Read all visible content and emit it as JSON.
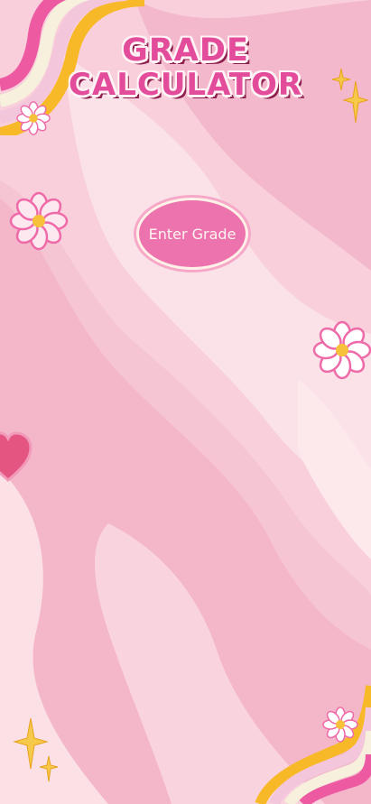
{
  "app": {
    "title_line1": "GRADE",
    "title_line2": "CALCULATOR"
  },
  "main": {
    "enter_button_label": "Enter Grade"
  },
  "colors": {
    "background": "#f9d6df",
    "title": "#e24c9a",
    "button": "#ec73ad",
    "accent_yellow": "#f7b928",
    "heart": "#e55582"
  },
  "decorations": {
    "icons": [
      "rainbow-icon",
      "daisy-icon",
      "sparkle-icon",
      "heart-icon"
    ]
  }
}
